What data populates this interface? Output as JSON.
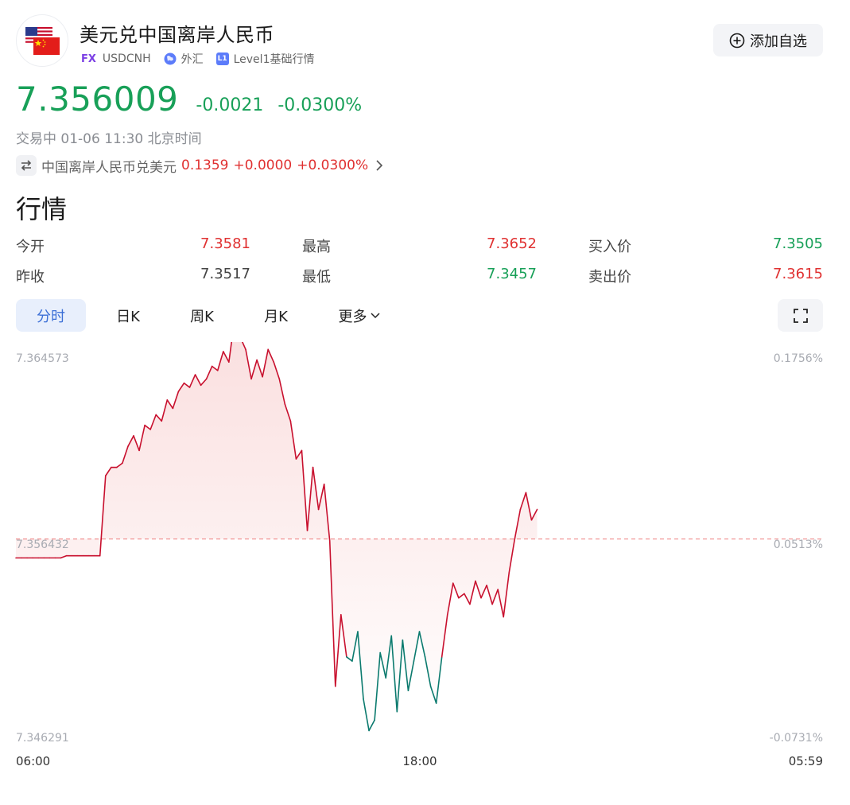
{
  "header": {
    "title": "美元兑中国离岸人民币",
    "fx_badge": "FX",
    "symbol": "USDCNH",
    "market": "外汇",
    "level_badge": "L1",
    "level": "Level1基础行情",
    "add_label": "添加自选"
  },
  "quote": {
    "price": "7.356009",
    "change": "-0.0021",
    "change_pct": "-0.0300%",
    "status": "交易中 01-06 11:30 北京时间"
  },
  "inverse": {
    "name": "中国离岸人民币兑美元",
    "price": "0.1359",
    "change": "+0.0000",
    "change_pct": "+0.0300%"
  },
  "section_title": "行情",
  "stats": {
    "open_label": "今开",
    "open": "7.3581",
    "high_label": "最高",
    "high": "7.3652",
    "bid_label": "买入价",
    "bid": "7.3505",
    "prev_label": "昨收",
    "prev": "7.3517",
    "low_label": "最低",
    "low": "7.3457",
    "ask_label": "卖出价",
    "ask": "7.3615"
  },
  "tabs": [
    "分时",
    "日K",
    "周K",
    "月K",
    "更多"
  ],
  "colors": {
    "up": "#e03131",
    "down": "#18a058",
    "line_up": "#c8102e",
    "line_down": "#0b7a6e",
    "accent": "#3b6fd6"
  },
  "chart_data": {
    "type": "line",
    "y_labels": [
      "7.364573",
      "7.356432",
      "7.346291"
    ],
    "pct_labels": [
      "0.1756%",
      "0.0513%",
      "-0.0731%"
    ],
    "x_labels": [
      "06:00",
      "18:00",
      "05:59"
    ],
    "baseline": 7.3556,
    "ylim": [
      7.346291,
      7.364573
    ],
    "series": [
      {
        "values": [
          7.3547,
          7.3547,
          7.3547,
          7.3547,
          7.3547,
          7.3547,
          7.3547,
          7.3547,
          7.3547,
          7.3548,
          7.3548,
          7.3548,
          7.3548,
          7.3548,
          7.3548,
          7.3548,
          7.3586,
          7.359,
          7.359,
          7.3592,
          7.36,
          7.3605,
          7.3598,
          7.361,
          7.3608,
          7.3615,
          7.3612,
          7.3622,
          7.3618,
          7.3626,
          7.363,
          7.3628,
          7.3634,
          7.3629,
          7.3632,
          7.3638,
          7.3636,
          7.3645,
          7.364,
          7.366,
          7.3652,
          7.3646,
          7.3632,
          7.3641,
          7.3633,
          7.3646,
          7.364,
          7.3632,
          7.362,
          7.3612,
          7.3594,
          7.3598,
          7.356,
          7.359,
          7.357,
          7.3582,
          7.3555,
          7.3486,
          7.352,
          7.35,
          7.3498,
          7.3512,
          7.348,
          7.3465,
          7.347,
          7.3502,
          7.349,
          7.351,
          7.3474,
          7.3508,
          7.3484,
          7.3498,
          7.3512,
          7.35,
          7.3486,
          7.3478,
          7.35,
          7.352,
          7.3535,
          7.3528,
          7.353,
          7.3525,
          7.3536,
          7.3528,
          7.3534,
          7.3525,
          7.3532,
          7.3519,
          7.354,
          7.3556,
          7.357,
          7.3578,
          7.3565,
          7.357
        ]
      }
    ]
  }
}
